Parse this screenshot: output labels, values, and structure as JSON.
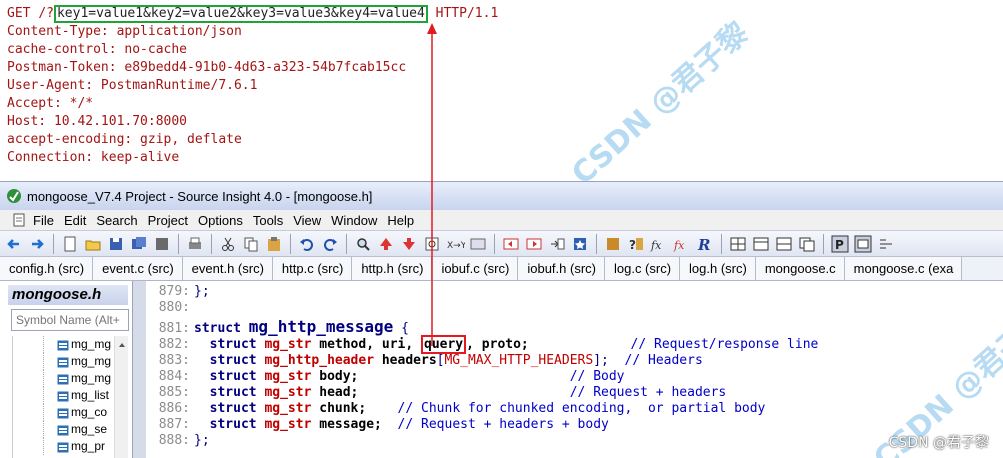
{
  "http": {
    "request_line": {
      "method": "GET",
      "path_prefix": "/?",
      "query": "key1=value1&key2=value2&key3=value3&key4=value4",
      "version": "HTTP/1.1"
    },
    "headers": [
      "Content-Type: application/json",
      "cache-control: no-cache",
      "Postman-Token: e89bedd4-91b0-4d63-a323-54b7fcab15cc",
      "User-Agent: PostmanRuntime/7.6.1",
      "Accept: */*",
      "Host: 10.42.101.70:8000",
      "accept-encoding: gzip, deflate",
      "Connection: keep-alive"
    ]
  },
  "watermark": {
    "text": "CSDN @君子黎",
    "credit": "CSDN @君子黎"
  },
  "window": {
    "title": "mongoose_V7.4 Project - Source Insight 4.0 - [mongoose.h]",
    "icon": "source-insight-app-icon"
  },
  "menu": [
    "File",
    "Edit",
    "Search",
    "Project",
    "Options",
    "Tools",
    "View",
    "Window",
    "Help"
  ],
  "toolbar": {
    "buttons": [
      "back-arrow-icon",
      "forward-arrow-icon",
      "sep",
      "new-file-icon",
      "open-folder-icon",
      "save-icon",
      "save-all-icon",
      "close-file-icon",
      "sep",
      "print-icon",
      "sep",
      "cut-icon",
      "copy-icon",
      "paste-icon",
      "sep",
      "undo-icon",
      "redo-icon",
      "sep",
      "find-icon",
      "find-prev-icon",
      "find-next-icon",
      "search-files-icon",
      "replace-icon",
      "browse-icon",
      "sep",
      "bookmark-prev-icon",
      "bookmark-next-icon",
      "bookmark-list-icon",
      "bookmark-icon",
      "sep",
      "lookup-icon",
      "jump-def-icon",
      "func-icon",
      "reference-icon",
      "relation-icon",
      "sep",
      "layout-a-icon",
      "layout-b-icon",
      "layout-c-icon",
      "layout-d-icon",
      "sep",
      "project-window-icon",
      "context-window-icon",
      "more-icon"
    ]
  },
  "tabs": [
    "config.h (src)",
    "event.c (src)",
    "event.h (src)",
    "http.c (src)",
    "http.h (src)",
    "iobuf.c (src)",
    "iobuf.h (src)",
    "log.c (src)",
    "log.h (src)",
    "mongoose.c",
    "mongoose.c (exa"
  ],
  "symbol_panel": {
    "title": "mongoose.h",
    "search_placeholder": "Symbol Name (Alt+",
    "items": [
      "mg_mg",
      "mg_mg",
      "mg_mg",
      "mg_list",
      "mg_co",
      "mg_se",
      "mg_pr"
    ]
  },
  "code": {
    "lines": [
      {
        "n": "879:",
        "text": "};"
      },
      {
        "n": "880:",
        "text": ""
      },
      {
        "n": "881:",
        "kw": "struct",
        "name": "mg_http_message",
        "rest": " {"
      },
      {
        "n": "882:",
        "kw": "struct",
        "type": "mg_str",
        "fields_a": "method, uri, ",
        "query": "query",
        "fields_b": ", proto;",
        "comment": "// Request/response line"
      },
      {
        "n": "883:",
        "kw": "struct",
        "type": "mg_http_header",
        "field": "headers",
        "macro": "MG_MAX_HTTP_HEADERS",
        "tail": "];",
        "comment": "// Headers"
      },
      {
        "n": "884:",
        "kw": "struct",
        "type": "mg_str",
        "field": "body;",
        "comment": "// Body"
      },
      {
        "n": "885:",
        "kw": "struct",
        "type": "mg_str",
        "field": "head;",
        "comment": "// Request + headers"
      },
      {
        "n": "886:",
        "kw": "struct",
        "type": "mg_str",
        "field": "chunk;",
        "comment": "// Chunk for chunked encoding,  or partial body"
      },
      {
        "n": "887:",
        "kw": "struct",
        "type": "mg_str",
        "field": "message;",
        "comment": "// Request + headers + body"
      },
      {
        "n": "888:",
        "text": "};"
      }
    ]
  },
  "colors": {
    "header_text": "#a31515",
    "query_highlight": "#22a33a",
    "code_highlight": "#e21b22",
    "arrow": "#e21b22",
    "keyword": "#000080",
    "comment": "#0000c8"
  }
}
